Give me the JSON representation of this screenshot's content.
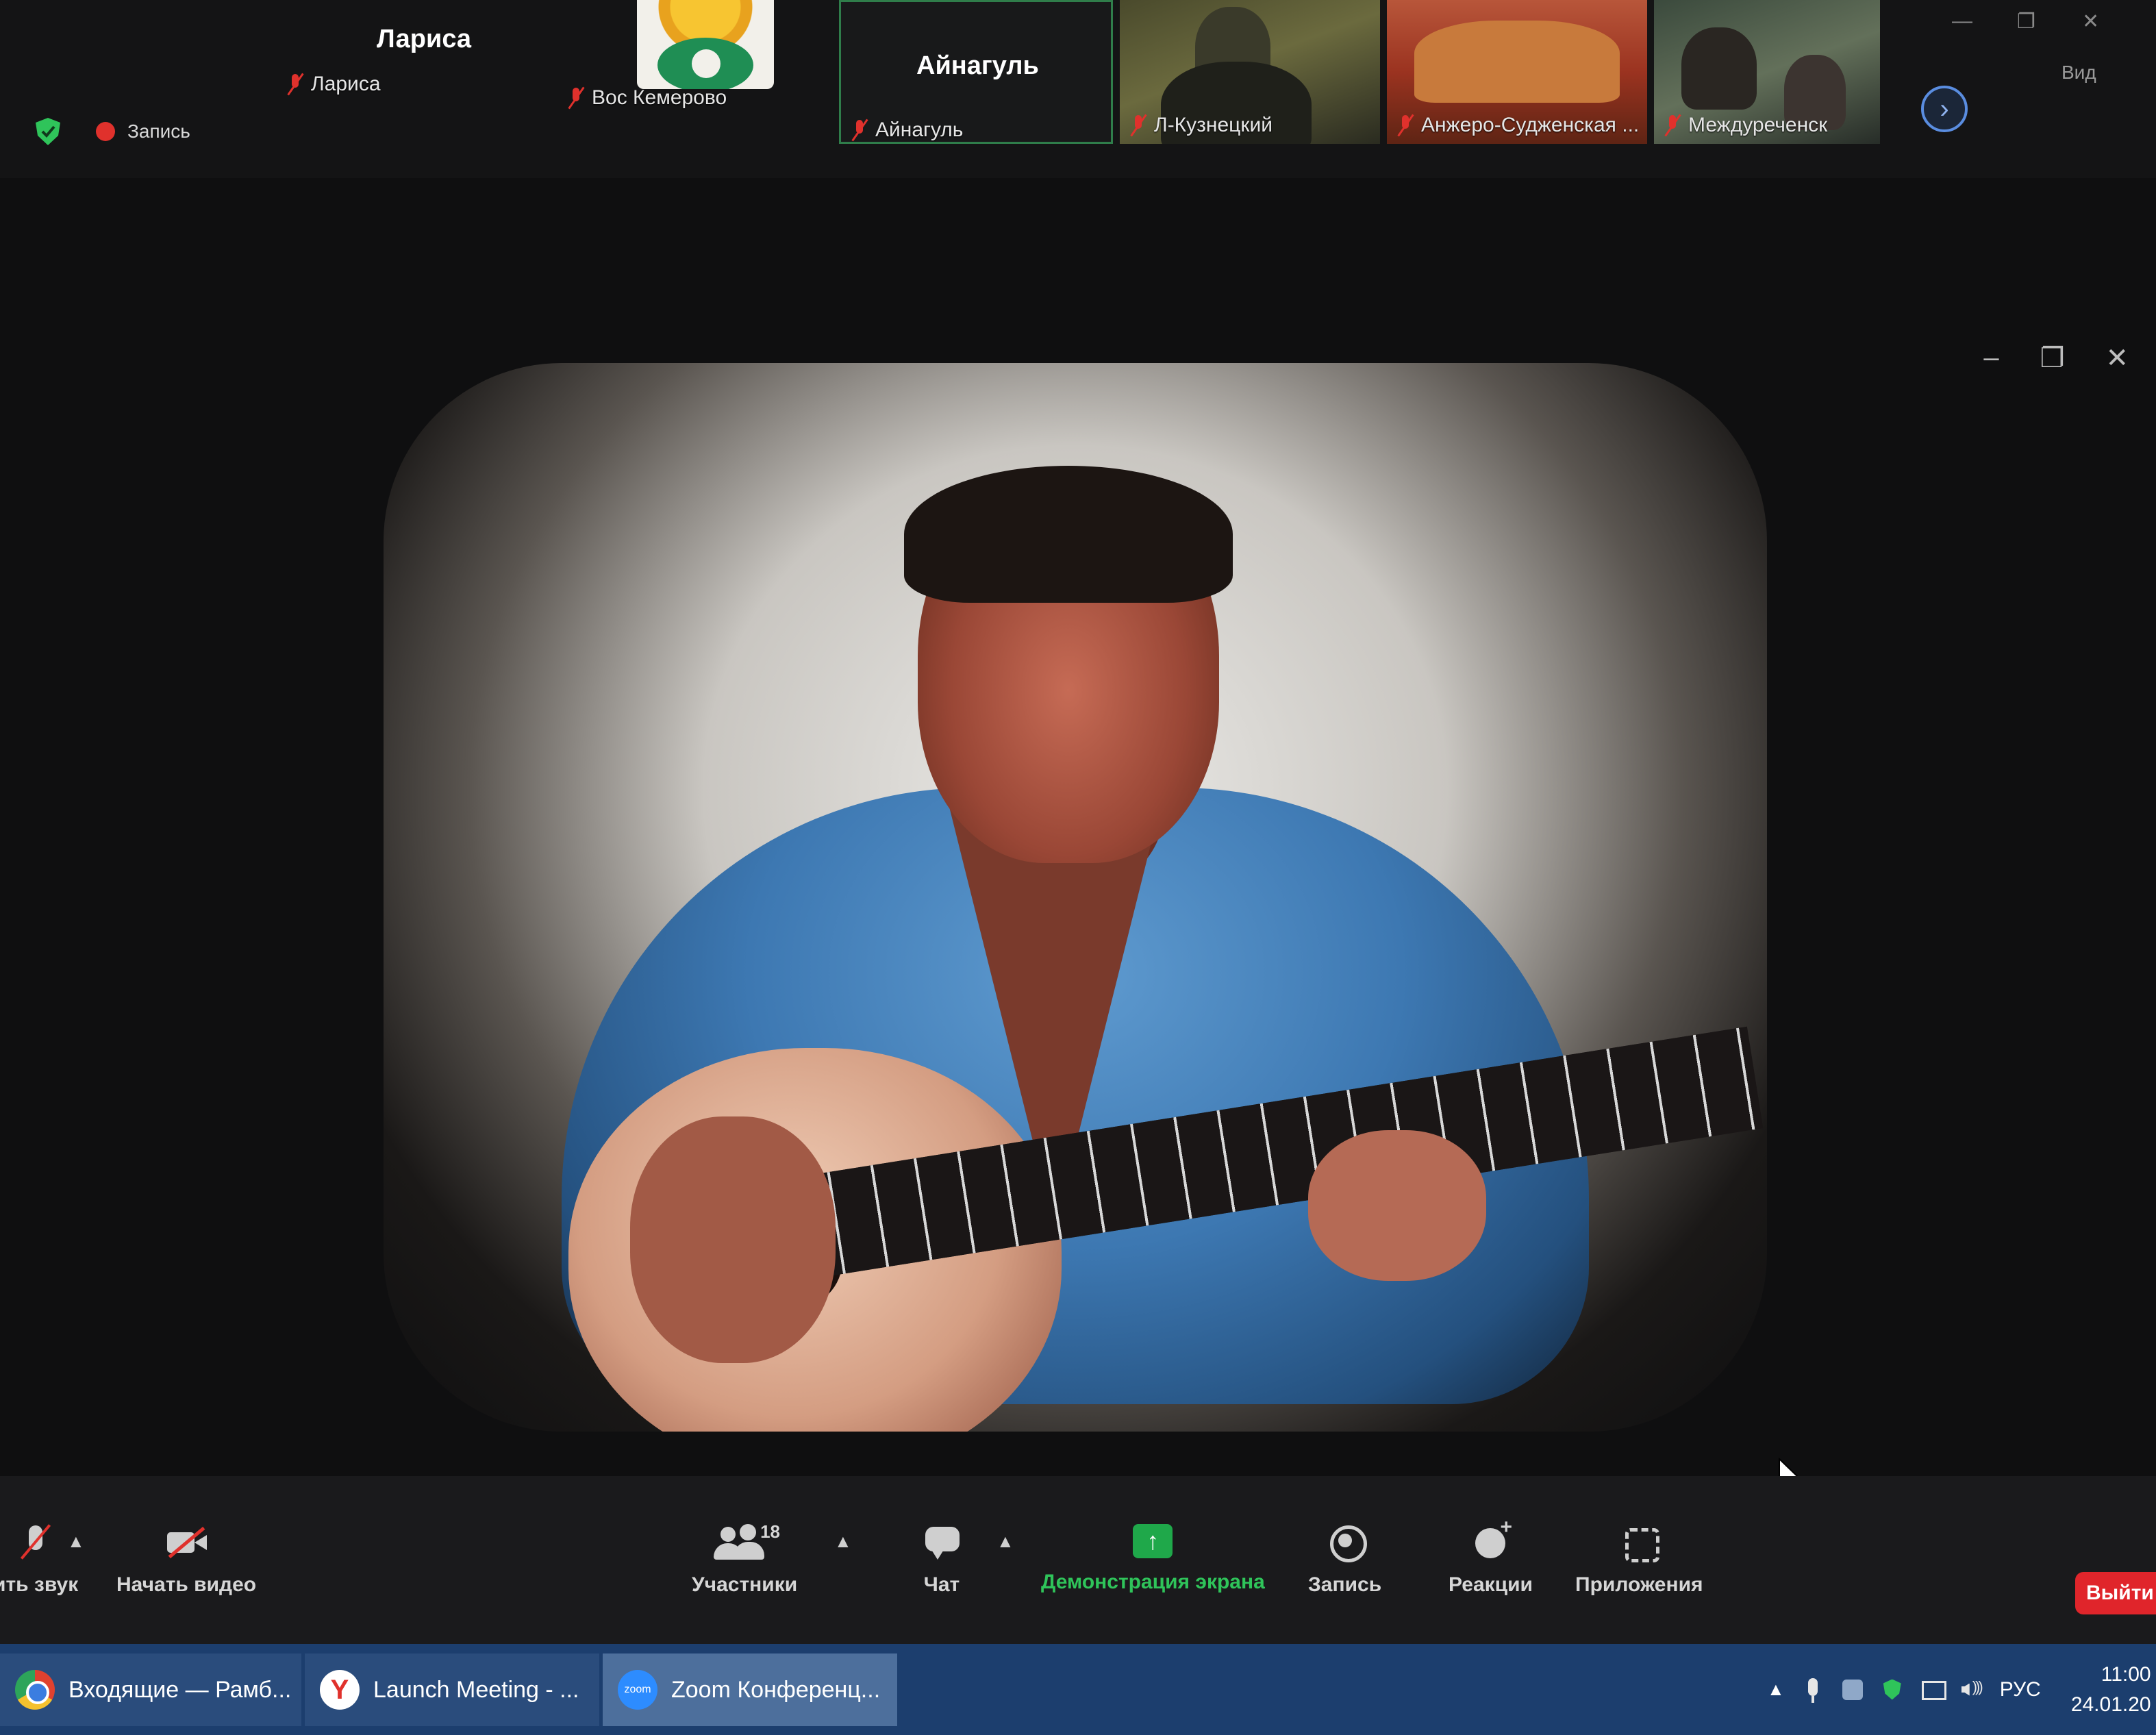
{
  "meeting": {
    "recording_label": "Запись"
  },
  "participants": [
    {
      "id": "larisa",
      "display_name": "Лариса",
      "caption": "Лариса",
      "muted": true
    },
    {
      "id": "vos",
      "caption": "Вос Кемерово",
      "muted": true
    },
    {
      "id": "aynagul",
      "display_name": "Айнагуль",
      "caption": "Айнагуль",
      "muted": true,
      "active": true
    },
    {
      "id": "lk",
      "caption": "Л-Кузнецкий",
      "muted": true
    },
    {
      "id": "anzh",
      "caption": "Анжеро-Судженская ...",
      "muted": true
    },
    {
      "id": "mezh",
      "caption": "Междуреченск",
      "muted": true
    }
  ],
  "strip": {
    "next_icon": "chevron-right-icon",
    "view_label": "Вид"
  },
  "main_window_controls": [
    "minimize-icon",
    "restore-icon",
    "close-icon"
  ],
  "toolbar": {
    "audio_label": "ить звук",
    "video_label": "Начать видео",
    "participants_label": "Участники",
    "participants_count": "18",
    "chat_label": "Чат",
    "share_label": "Демонстрация экрана",
    "record_label": "Запись",
    "reactions_label": "Реакции",
    "apps_label": "Приложения",
    "leave_label": "Выйти"
  },
  "taskbar": {
    "tasks": [
      {
        "id": "chrome",
        "icon": "chrome-icon",
        "label": "Входящие — Рамб..."
      },
      {
        "id": "yandex",
        "icon": "yandex-browser-icon",
        "label": "Launch Meeting - ..."
      },
      {
        "id": "zoom",
        "icon": "zoom-icon",
        "label": "Zoom Конференц...",
        "active": true
      }
    ],
    "tray": {
      "language": "РУС",
      "time": "11:00",
      "date": "24.01.20"
    }
  },
  "colors": {
    "recording_red": "#e0312c",
    "share_green": "#1fa84a",
    "leave_red": "#e0252b",
    "taskbar_blue": "#1c3e6e",
    "active_speaker_border": "#2f7d4a"
  }
}
